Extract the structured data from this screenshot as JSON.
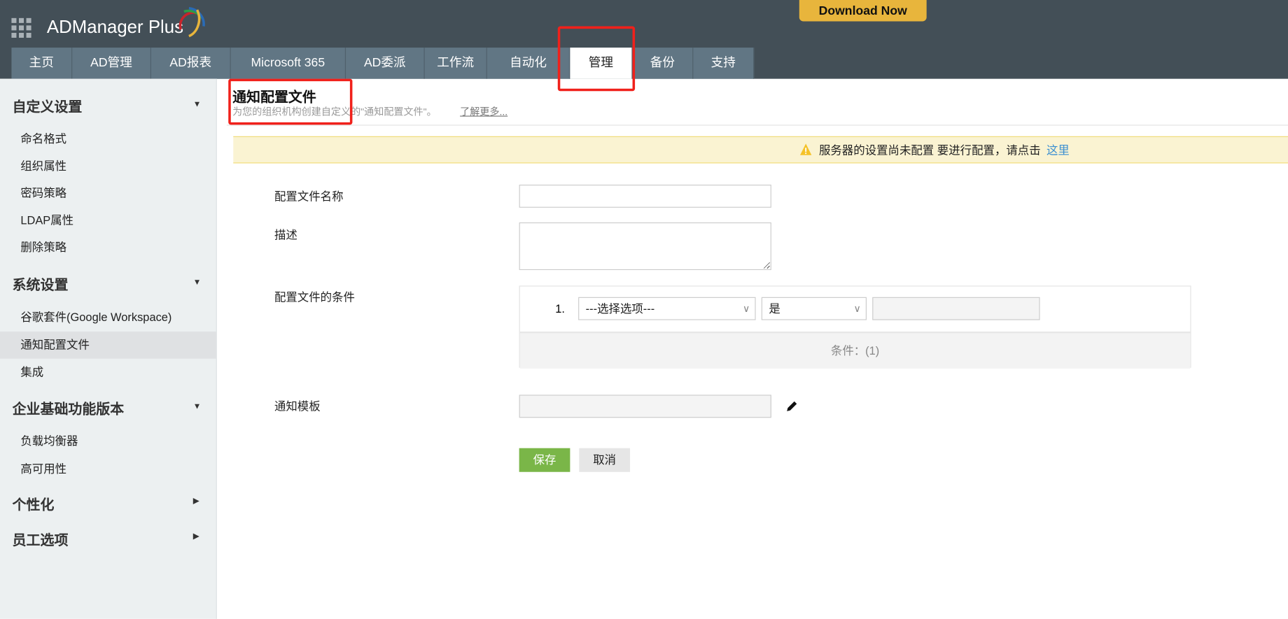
{
  "header": {
    "logo": "ADManager Plus",
    "download_label": "Download Now"
  },
  "tabs": [
    {
      "label": "主页"
    },
    {
      "label": "AD管理"
    },
    {
      "label": "AD报表"
    },
    {
      "label": "Microsoft 365"
    },
    {
      "label": "AD委派"
    },
    {
      "label": "工作流"
    },
    {
      "label": "自动化"
    },
    {
      "label": "管理",
      "active": true
    },
    {
      "label": "备份"
    },
    {
      "label": "支持"
    }
  ],
  "sidebar": {
    "sections": [
      {
        "label": "自定义设置",
        "items": [
          "命名格式",
          "组织属性",
          "密码策略",
          "LDAP属性",
          "删除策略"
        ]
      },
      {
        "label": "系统设置",
        "items": [
          "谷歌套件(Google Workspace)",
          "通知配置文件",
          "集成"
        ]
      },
      {
        "label": "企业基础功能版本",
        "items": [
          "负载均衡器",
          "高可用性"
        ]
      },
      {
        "label": "个性化",
        "items": []
      },
      {
        "label": "员工选项",
        "items": []
      }
    ],
    "active_item": "通知配置文件"
  },
  "page": {
    "title": "通知配置文件",
    "subtitle": "为您的组织机构创建自定义的\"通知配置文件\"。",
    "learn_more": "了解更多..."
  },
  "banner": {
    "text": "服务器的设置尚未配置 要进行配置，请点击",
    "link": "这里",
    "color": "#faf3d2"
  },
  "form": {
    "name_label": "配置文件名称",
    "name_value": "",
    "desc_label": "描述",
    "desc_value": "",
    "cond_label": "配置文件的条件",
    "condition": {
      "index": "1.",
      "attribute": "---选择选项---",
      "operator": "是",
      "value": ""
    },
    "cond_count": "条件：(1)",
    "template_label": "通知模板",
    "template_value": "",
    "save": "保存",
    "cancel": "取消"
  },
  "colors": {
    "header": "#434f57",
    "tab": "#617684",
    "accent_save": "#7ab648",
    "download": "#e8b53c",
    "highlight": "#f0211b"
  }
}
